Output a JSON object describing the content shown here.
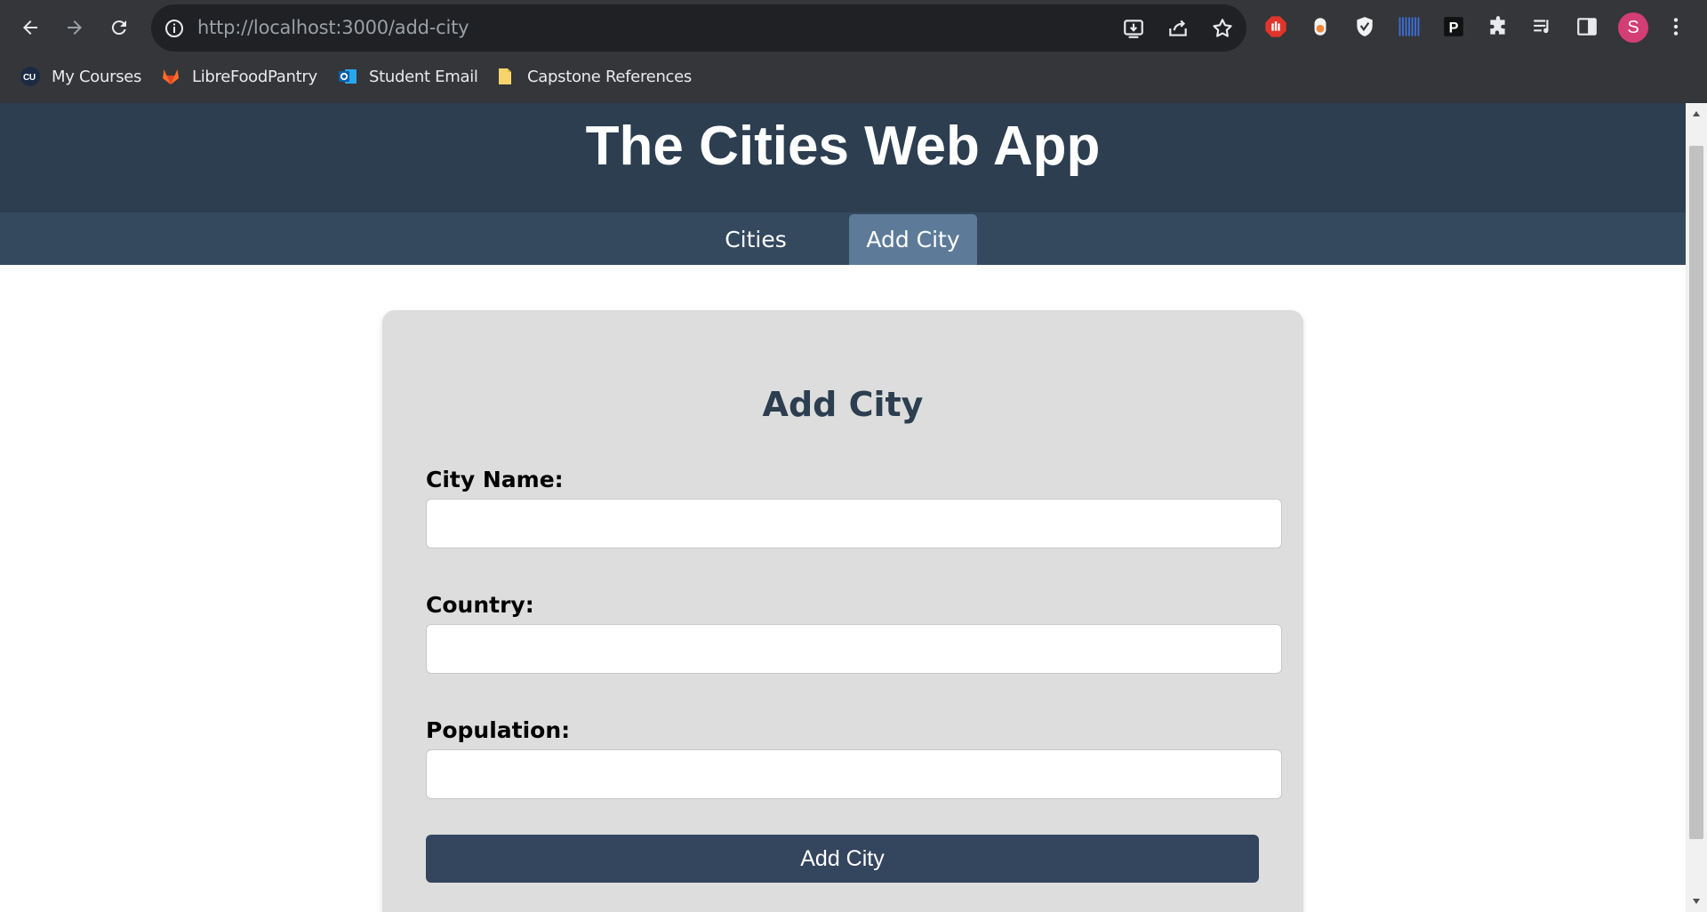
{
  "browser": {
    "url_host": "http://localhost",
    "url_rest": ":3000/add-city",
    "bookmarks": [
      {
        "label": "My Courses",
        "icon": "cu-icon"
      },
      {
        "label": "LibreFoodPantry",
        "icon": "gitlab-icon"
      },
      {
        "label": "Student Email",
        "icon": "outlook-icon"
      },
      {
        "label": "Capstone References",
        "icon": "folder-icon"
      }
    ],
    "profile_initial": "S",
    "colors": {
      "frame": "#35363a",
      "omnibox": "#202124",
      "avatar": "#d33e74"
    }
  },
  "app": {
    "title": "The Cities Web App",
    "nav": [
      {
        "label": "Cities",
        "active": false
      },
      {
        "label": "Add City",
        "active": true
      }
    ],
    "colors": {
      "header": "#2c3e50",
      "nav": "#34495e",
      "nav_active": "#5d7b98",
      "card": "#dddddd",
      "button": "#34455e"
    }
  },
  "form": {
    "title": "Add City",
    "fields": [
      {
        "label": "City Name:",
        "value": ""
      },
      {
        "label": "Country:",
        "value": ""
      },
      {
        "label": "Population:",
        "value": ""
      }
    ],
    "submit_label": "Add City"
  }
}
